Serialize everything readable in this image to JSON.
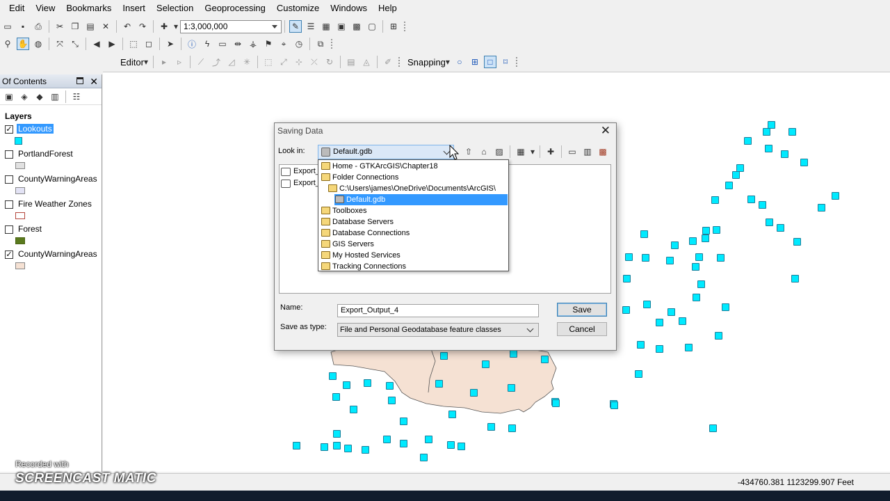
{
  "menu": [
    "Edit",
    "View",
    "Bookmarks",
    "Insert",
    "Selection",
    "Geoprocessing",
    "Customize",
    "Windows",
    "Help"
  ],
  "toolbar": {
    "scale": "1:3,000,000",
    "editor_label": "Editor",
    "snapping_label": "Snapping"
  },
  "toc": {
    "title": "Of Contents",
    "root": "Layers",
    "layers": [
      {
        "name": "Lookouts",
        "checked": true,
        "selected": true,
        "symbol": "lookout"
      },
      {
        "name": "PortlandForest",
        "checked": false,
        "selected": false,
        "symbol": "fill-grey"
      },
      {
        "name": "CountyWarningAreas",
        "checked": false,
        "selected": false,
        "symbol": "fill-lavender"
      },
      {
        "name": "Fire Weather Zones",
        "checked": false,
        "selected": false,
        "symbol": "outline-red"
      },
      {
        "name": "Forest",
        "checked": false,
        "selected": false,
        "symbol": "fill-olive"
      },
      {
        "name": "CountyWarningAreas",
        "checked": true,
        "selected": false,
        "symbol": "fill-peach"
      }
    ]
  },
  "dialog": {
    "title": "Saving Data",
    "look_in_label": "Look in:",
    "look_in_value": "Default.gdb",
    "files": [
      "Export_",
      "Export_"
    ],
    "name_label": "Name:",
    "name_value": "Export_Output_4",
    "type_label": "Save as type:",
    "type_value": "File and Personal Geodatabase feature classes",
    "save_label": "Save",
    "cancel_label": "Cancel",
    "dropdown": [
      {
        "label": "Home - GTKArcGIS\\Chapter18",
        "indent": 0,
        "selected": false
      },
      {
        "label": "Folder Connections",
        "indent": 0,
        "selected": false
      },
      {
        "label": "C:\\Users\\james\\OneDrive\\Documents\\ArcGIS\\",
        "indent": 1,
        "selected": false
      },
      {
        "label": "Default.gdb",
        "indent": 2,
        "selected": true
      },
      {
        "label": "Toolboxes",
        "indent": 0,
        "selected": false
      },
      {
        "label": "Database Servers",
        "indent": 0,
        "selected": false
      },
      {
        "label": "Database Connections",
        "indent": 0,
        "selected": false
      },
      {
        "label": "GIS Servers",
        "indent": 0,
        "selected": false
      },
      {
        "label": "My Hosted Services",
        "indent": 0,
        "selected": false
      },
      {
        "label": "Tracking Connections",
        "indent": 0,
        "selected": false
      }
    ]
  },
  "status": {
    "coords": "-434760.381  1123299.907 Feet"
  },
  "watermark": {
    "line1": "Recorded with",
    "line2": "SCREENCAST MATIC"
  },
  "colors": {
    "point_fill": "#00eaff",
    "region_fill": "#f5e1d3",
    "selection": "#3399ff"
  }
}
